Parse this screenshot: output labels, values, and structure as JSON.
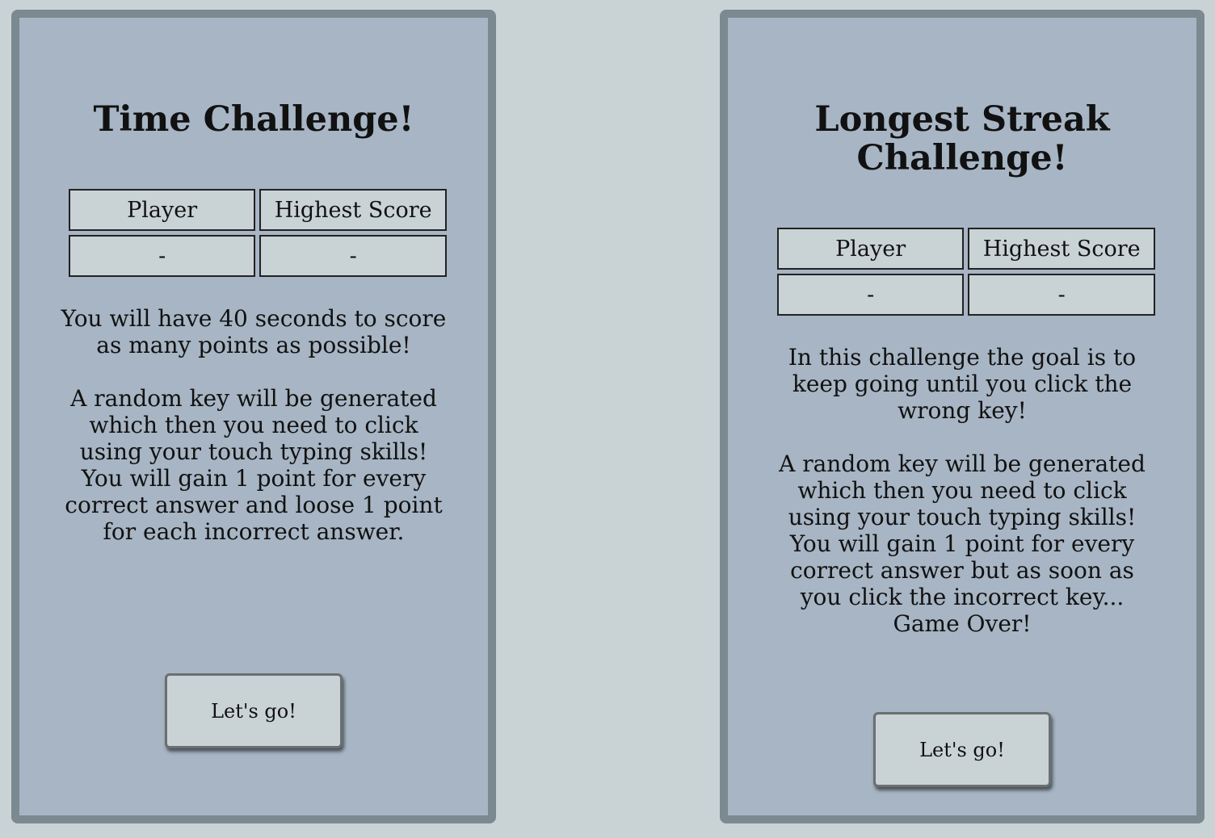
{
  "challenges": [
    {
      "title": "Time Challenge!",
      "table_headers": [
        "Player",
        "Highest Score"
      ],
      "player_value": "-",
      "score_value": "-",
      "description": [
        "You will have 40 seconds to score as many points as possible!",
        "A random key will be generated which then you need to click using your touch typing skills! You will gain 1 point for every correct answer and loose 1 point for each incorrect answer."
      ],
      "button_label": "Let's go!"
    },
    {
      "title": "Longest Streak Challenge!",
      "table_headers": [
        "Player",
        "Highest Score"
      ],
      "player_value": "-",
      "score_value": "-",
      "description": [
        "In this challenge the goal is to keep going until you click the wrong key!",
        "A random key will be generated which then you need to click using your touch typing skills! You will gain 1 point for every correct answer but as soon as you click the incorrect key... Game Over!"
      ],
      "button_label": "Let's go!"
    }
  ]
}
